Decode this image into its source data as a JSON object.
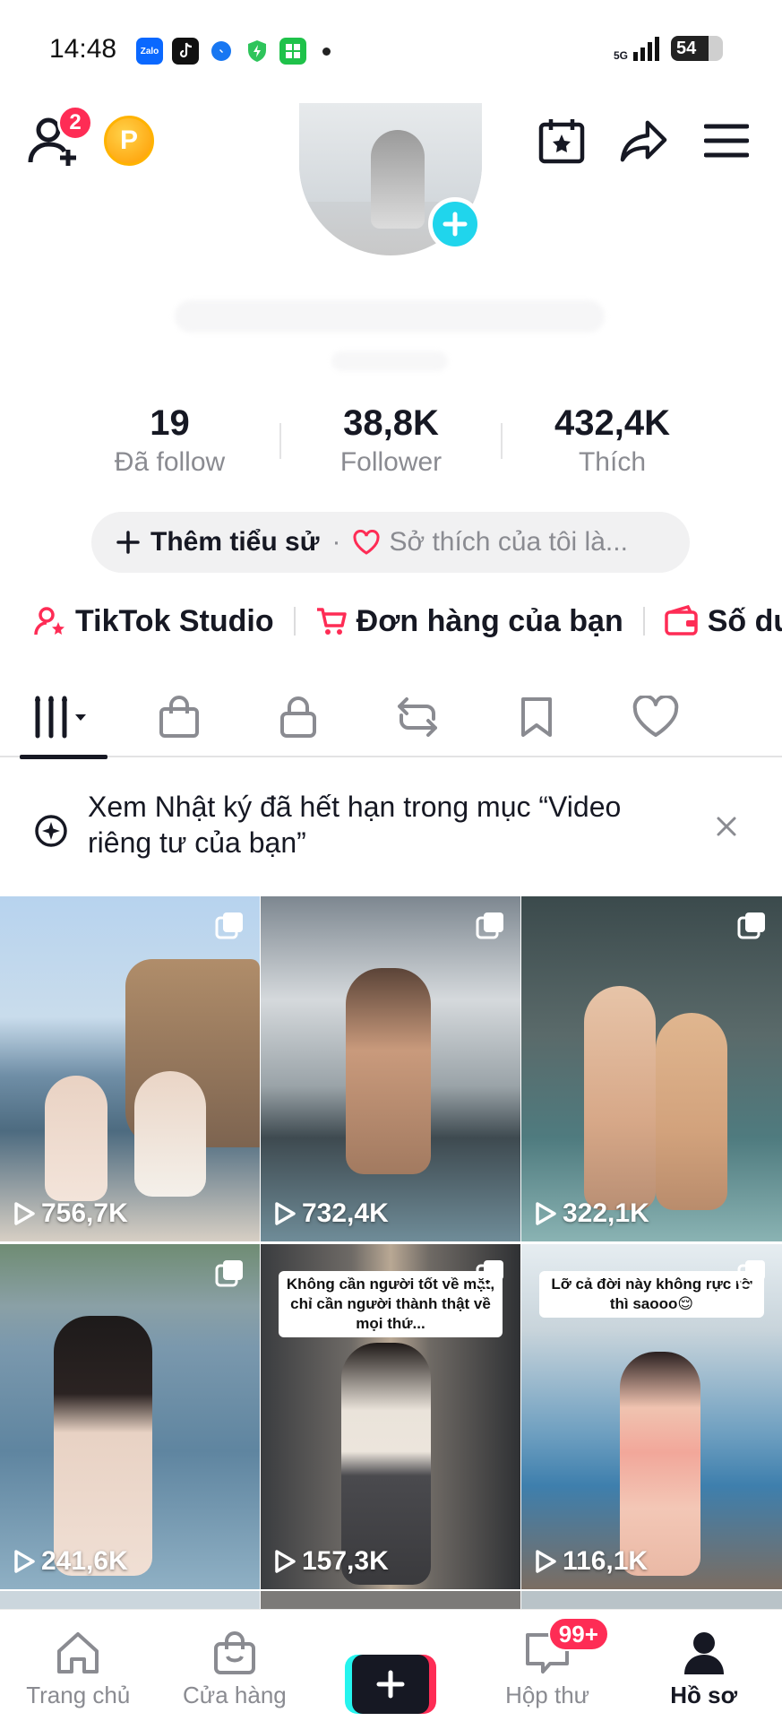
{
  "status_bar": {
    "time": "14:48",
    "network": "5G",
    "battery": "54"
  },
  "header": {
    "friend_badge": "2",
    "coin_letter": "P"
  },
  "stats": [
    {
      "value": "19",
      "label": "Đã follow"
    },
    {
      "value": "38,8K",
      "label": "Follower"
    },
    {
      "value": "432,4K",
      "label": "Thích"
    }
  ],
  "bio": {
    "add_label": "Thêm tiểu sử",
    "separator": "·",
    "hobby_label": "Sở thích của tôi là..."
  },
  "shortcuts": [
    {
      "label": "TikTok Studio"
    },
    {
      "label": "Đơn hàng của bạn"
    },
    {
      "label": "Số dư"
    }
  ],
  "notice": {
    "text": "Xem Nhật ký đã hết hạn trong mục “Video riêng tư của bạn”"
  },
  "videos": [
    {
      "views": "756,7K"
    },
    {
      "views": "732,4K"
    },
    {
      "views": "322,1K"
    },
    {
      "views": "241,6K"
    },
    {
      "views": "157,3K",
      "caption": "Không cần người tốt về mặt, chỉ cần người thành thật về mọi thứ..."
    },
    {
      "views": "116,1K",
      "caption": "Lỡ cả đời này không rực rỡ thì saooo😌"
    }
  ],
  "bottom_nav": {
    "home": "Trang chủ",
    "shop": "Cửa hàng",
    "inbox": "Hộp thư",
    "inbox_badge": "99+",
    "profile": "Hồ sơ"
  },
  "colors": {
    "accent_red": "#fe2c55",
    "accent_cyan": "#20d5ec",
    "text_primary": "#161823",
    "text_secondary": "#8a8b91"
  }
}
